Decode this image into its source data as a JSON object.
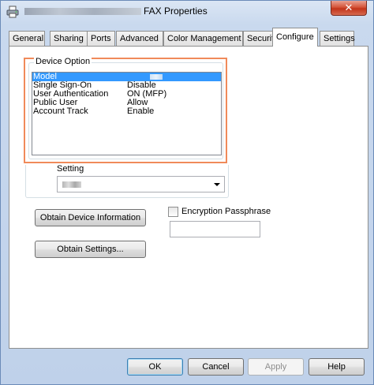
{
  "window": {
    "title": "FAX Properties",
    "close_label": "✕"
  },
  "tabs": [
    {
      "label": "General"
    },
    {
      "label": "Sharing"
    },
    {
      "label": "Ports"
    },
    {
      "label": "Advanced"
    },
    {
      "label": "Color Management"
    },
    {
      "label": "Security"
    },
    {
      "label": "Configure",
      "active": true
    },
    {
      "label": "Settings"
    }
  ],
  "device_option": {
    "label": "Device Option",
    "items": [
      {
        "name": "Model",
        "value": "",
        "selected": true
      },
      {
        "name": "Single Sign-On",
        "value": "Disable"
      },
      {
        "name": "User Authentication",
        "value": "ON (MFP)"
      },
      {
        "name": "Public User",
        "value": "Allow"
      },
      {
        "name": "Account Track",
        "value": "Enable"
      }
    ]
  },
  "setting": {
    "label": "Setting",
    "selected_value": ""
  },
  "buttons": {
    "obtain_device_info": "Obtain Device Information",
    "obtain_settings": "Obtain Settings..."
  },
  "encryption": {
    "label": "Encryption Passphrase",
    "checked": false,
    "value": ""
  },
  "dialog_buttons": {
    "ok": "OK",
    "cancel": "Cancel",
    "apply": "Apply",
    "help": "Help"
  }
}
